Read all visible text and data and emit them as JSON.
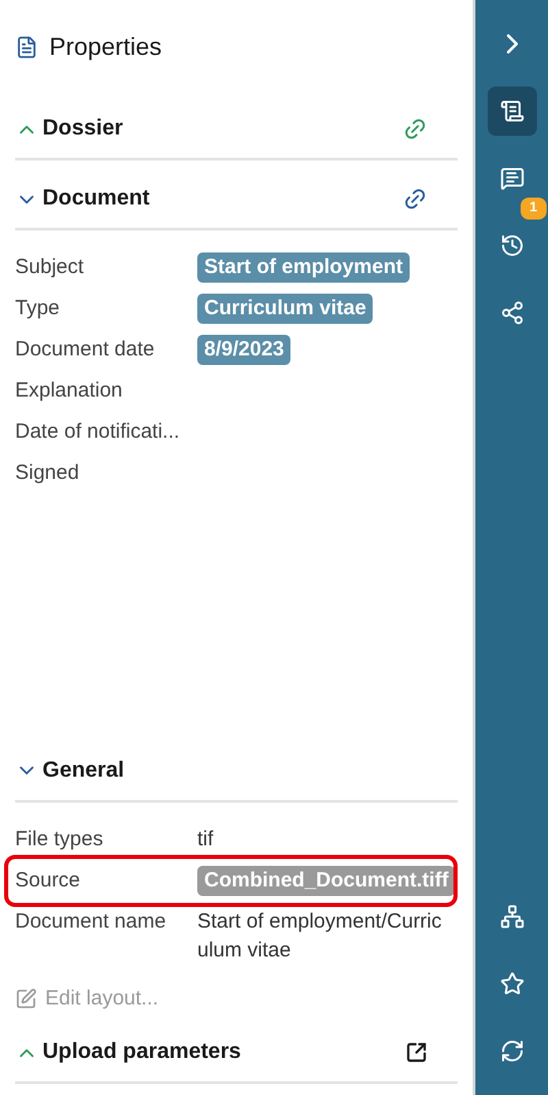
{
  "panel": {
    "title": "Properties"
  },
  "sections": [
    {
      "title": "Dossier",
      "expanded": false,
      "color": "#2e9b5a"
    },
    {
      "title": "Document",
      "expanded": true,
      "color": "#2a5d9c",
      "rows": [
        {
          "label": "Subject",
          "value": "Start of employment",
          "kind": "chip",
          "color": "#5b8ea8",
          "highlighted": false
        },
        {
          "label": "Type",
          "value": "Curriculum vitae",
          "kind": "chip",
          "color": "#5b8ea8",
          "highlighted": false
        },
        {
          "label": "Document date",
          "value": "8/9/2023",
          "kind": "chip",
          "color": "#5b8ea8",
          "highlighted": false
        },
        {
          "label": "Explanation",
          "kind": "empty",
          "highlighted": false
        },
        {
          "label": "Date of notificati...",
          "kind": "empty",
          "highlighted": false
        },
        {
          "label": "Signed",
          "kind": "empty",
          "highlighted": false
        }
      ]
    },
    {
      "title": "General",
      "expanded": true,
      "rows": [
        {
          "label": "File types",
          "value": "tif",
          "kind": "text",
          "highlighted": false
        },
        {
          "label": "Source",
          "value": "Combined_Document.tiff",
          "kind": "chip",
          "color": "#9a9a9a",
          "highlighted": true
        },
        {
          "label": "Document name",
          "value": "Start of employment/Curriculum vitae",
          "kind": "text",
          "highlighted": false
        }
      ],
      "footer": {
        "label": "Edit layout...",
        "disabled": true
      }
    },
    {
      "title": "Upload parameters",
      "expanded": false,
      "color": "#1a1a1a"
    }
  ],
  "rail": {
    "top": [
      {
        "selected": false
      },
      {
        "selected": true
      },
      {
        "selected": false,
        "badge": "1"
      },
      {
        "selected": false
      },
      {
        "selected": false
      }
    ],
    "bottom": [
      {
        "selected": false
      },
      {
        "selected": false
      },
      {
        "selected": false
      }
    ]
  }
}
